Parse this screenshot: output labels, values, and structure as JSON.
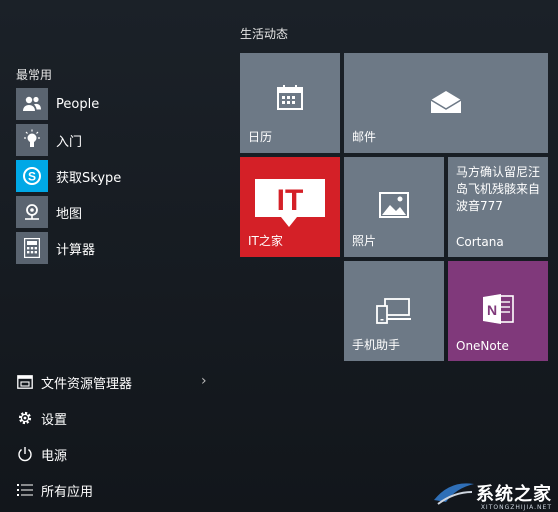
{
  "left": {
    "frequent_heading": "最常用",
    "apps": [
      {
        "label": "People",
        "icon": "people-icon",
        "color": "#5a6470"
      },
      {
        "label": "入门",
        "icon": "lightbulb-icon",
        "color": "#5a6470"
      },
      {
        "label": "获取Skype",
        "icon": "skype-icon",
        "color": "#00a8e6"
      },
      {
        "label": "地图",
        "icon": "maps-icon",
        "color": "#5a6470"
      },
      {
        "label": "计算器",
        "icon": "calculator-icon",
        "color": "#5a6470"
      }
    ],
    "system": [
      {
        "label": "文件资源管理器",
        "icon": "file-explorer-icon"
      },
      {
        "label": "设置",
        "icon": "settings-gear-icon"
      },
      {
        "label": "电源",
        "icon": "power-icon"
      },
      {
        "label": "所有应用",
        "icon": "all-apps-icon"
      }
    ]
  },
  "tiles": {
    "group_heading": "生活动态",
    "calendar": {
      "label": "日历",
      "icon": "calendar-icon",
      "color": "#6d7986"
    },
    "mail": {
      "label": "邮件",
      "icon": "mail-icon",
      "color": "#6d7986"
    },
    "ithome": {
      "label": "IT之家",
      "logo_text": "IT",
      "color": "#d42027"
    },
    "photos": {
      "label": "照片",
      "icon": "photos-icon",
      "color": "#6d7986"
    },
    "cortana": {
      "label": "Cortana",
      "news": "马方确认留尼汪岛飞机残骸来自波音777",
      "color": "#6d7986"
    },
    "phone": {
      "label": "手机助手",
      "icon": "phone-companion-icon",
      "color": "#6d7986"
    },
    "onenote": {
      "label": "OneNote",
      "icon": "onenote-icon",
      "color": "#80397b"
    }
  },
  "watermark": {
    "text": "系统之家",
    "sub": "XITONGZHIJIA.NET"
  }
}
